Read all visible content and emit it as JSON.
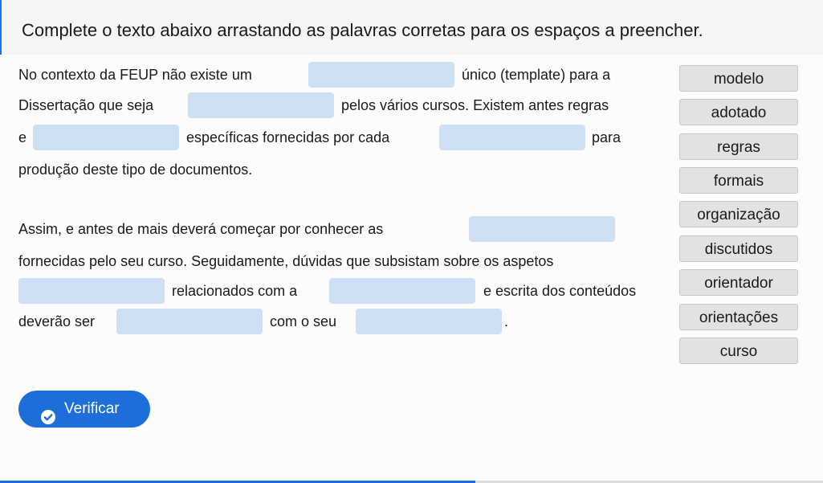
{
  "instruction": "Complete o texto abaixo arrastando as palavras corretas para os espaços a preencher.",
  "paragraph1": {
    "line1": [
      "No contexto da FEUP não existe um",
      "único (template) para a"
    ],
    "line2": [
      "Dissertação que seja",
      "pelos vários cursos. Existem antes regras"
    ],
    "line3": [
      "e",
      "específicas fornecidas por cada",
      "para"
    ],
    "line4": [
      "produção deste tipo de documentos."
    ]
  },
  "paragraph2": {
    "line1": [
      "Assim, e antes de mais deverá começar por conhecer as"
    ],
    "line2": [
      "fornecidas pelo seu curso. Seguidamente, dúvidas que subsistam sobre os aspetos"
    ],
    "line3": [
      "relacionados com a",
      "e escrita dos conteúdos"
    ],
    "line4": [
      "deverão ser",
      "com o seu",
      "."
    ]
  },
  "word_bank": [
    "modelo",
    "adotado",
    "regras",
    "formais",
    "organização",
    "discutidos",
    "orientador",
    "orientações",
    "curso"
  ],
  "verify_button": {
    "label": "Verificar",
    "icon": "check-circle-icon"
  },
  "colors": {
    "accent": "#1d6ed8",
    "blank": "#cfe0f5",
    "word_bg": "#e2e2e2"
  }
}
